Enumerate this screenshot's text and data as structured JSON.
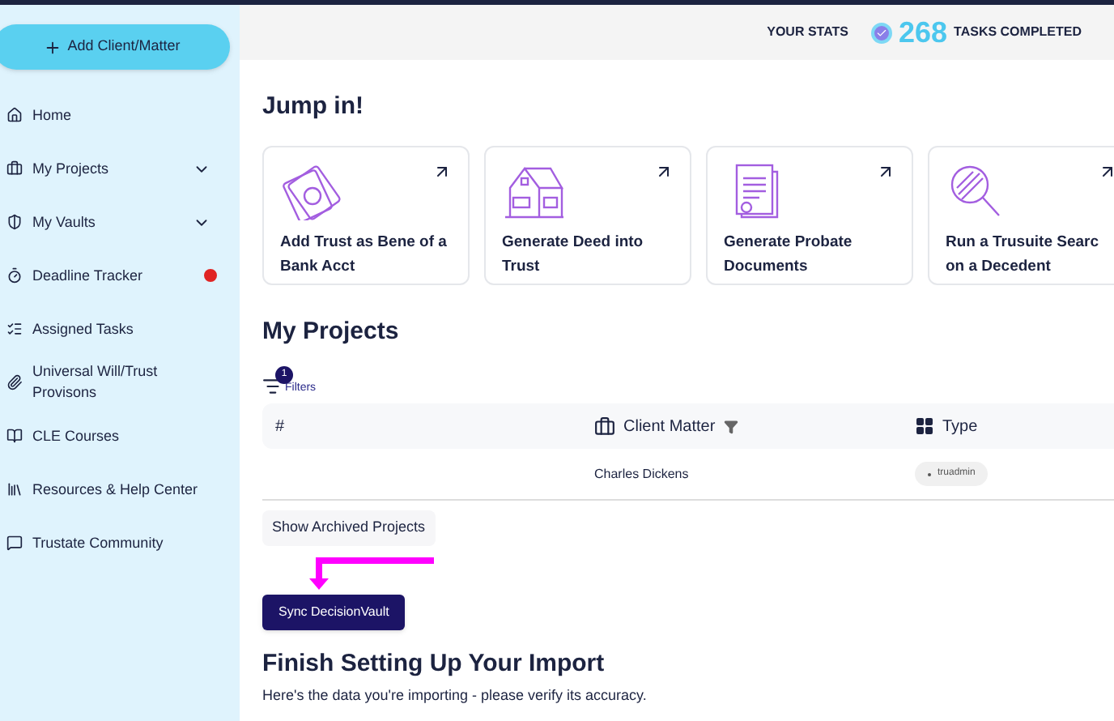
{
  "sidebar": {
    "add_button": "Add Client/Matter",
    "items": [
      {
        "label": "Home",
        "kind": "link"
      },
      {
        "label": "My Projects",
        "kind": "dropdown"
      },
      {
        "label": "My Vaults",
        "kind": "dropdown"
      },
      {
        "label": "Deadline Tracker",
        "kind": "alert"
      },
      {
        "label": "Assigned Tasks",
        "kind": "link"
      },
      {
        "label": "Universal Will/Trust Provisons",
        "kind": "link"
      },
      {
        "label": "CLE Courses",
        "kind": "link"
      },
      {
        "label": "Resources & Help Center",
        "kind": "link"
      },
      {
        "label": "Trustate Community",
        "kind": "link"
      }
    ]
  },
  "stats": {
    "label": "YOUR STATS",
    "count": "268",
    "caption": "TASKS COMPLETED"
  },
  "jump_in": {
    "title": "Jump in!",
    "cards": [
      {
        "kind": "money",
        "lines": [
          "Add Trust as Bene of a",
          "Bank Acct"
        ]
      },
      {
        "kind": "house",
        "lines": [
          "Generate Deed into",
          "Trust"
        ]
      },
      {
        "kind": "document",
        "lines": [
          "Generate Probate",
          "Documents"
        ]
      },
      {
        "kind": "magnifier",
        "lines": [
          "Run a Trusuite Searc",
          "on a Decedent"
        ]
      }
    ]
  },
  "projects": {
    "title": "My Projects",
    "filters": {
      "label": "Filters",
      "count": "1"
    },
    "columns": [
      {
        "label": "#",
        "kind": "plain"
      },
      {
        "label": "Client Matter",
        "kind": "briefcase"
      },
      {
        "label": "Type",
        "kind": "grid"
      }
    ],
    "rows": [
      {
        "client_matter": "Charles Dickens",
        "type": "truadmin"
      }
    ],
    "archived_button": "Show Archived Projects",
    "sync_button": "Sync DecisionVault"
  },
  "import": {
    "title": "Finish Setting Up Your Import",
    "subtitle": "Here's the data you're importing - please verify its accuracy."
  }
}
